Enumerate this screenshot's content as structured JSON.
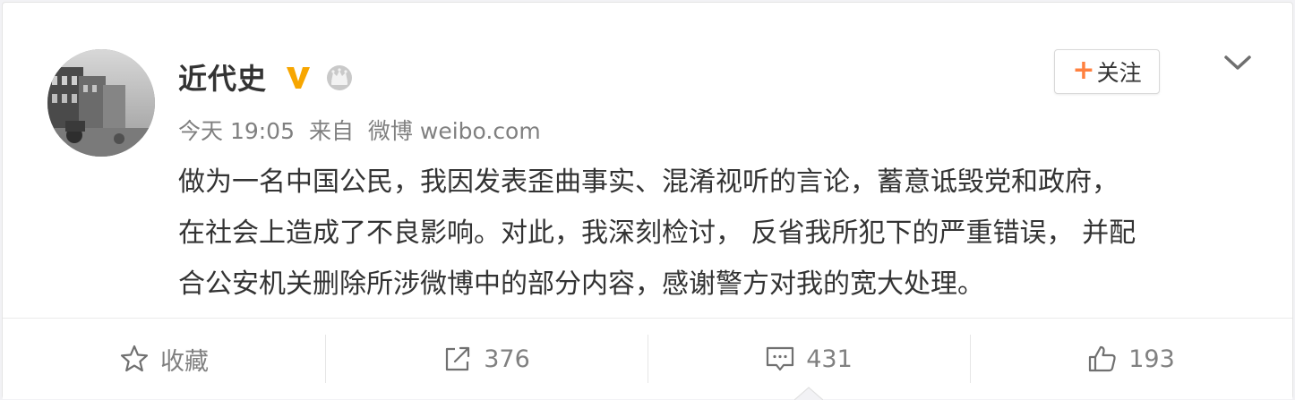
{
  "user": {
    "name": "近代史",
    "verified_icon": "verified-v-icon",
    "member_icon": "crown-icon"
  },
  "follow_button": {
    "plus": "+",
    "label": "关注"
  },
  "menu_icon": "chevron-down-icon",
  "meta": {
    "time": "今天 19:05",
    "from_label": "来自",
    "source": "微博 weibo.com"
  },
  "post": {
    "lines": [
      "做为一名中国公民，我因发表歪曲事实、混淆视听的言论，蓄意诋毁党和政府，",
      "在社会上造成了不良影响。对此，我深刻检讨， 反省我所犯下的严重错误， 并配",
      "合公安机关删除所涉微博中的部分内容，感谢警方对我的宽大处理。"
    ]
  },
  "actions": [
    {
      "icon": "star-icon",
      "label": "收藏"
    },
    {
      "icon": "share-icon",
      "label": "376"
    },
    {
      "icon": "comment-icon",
      "label": "431"
    },
    {
      "icon": "like-icon",
      "label": "193"
    }
  ],
  "colors": {
    "accent_orange": "#ff8140",
    "verified_gold": "#f7a600",
    "text_main": "#333333",
    "text_meta": "#808080"
  }
}
